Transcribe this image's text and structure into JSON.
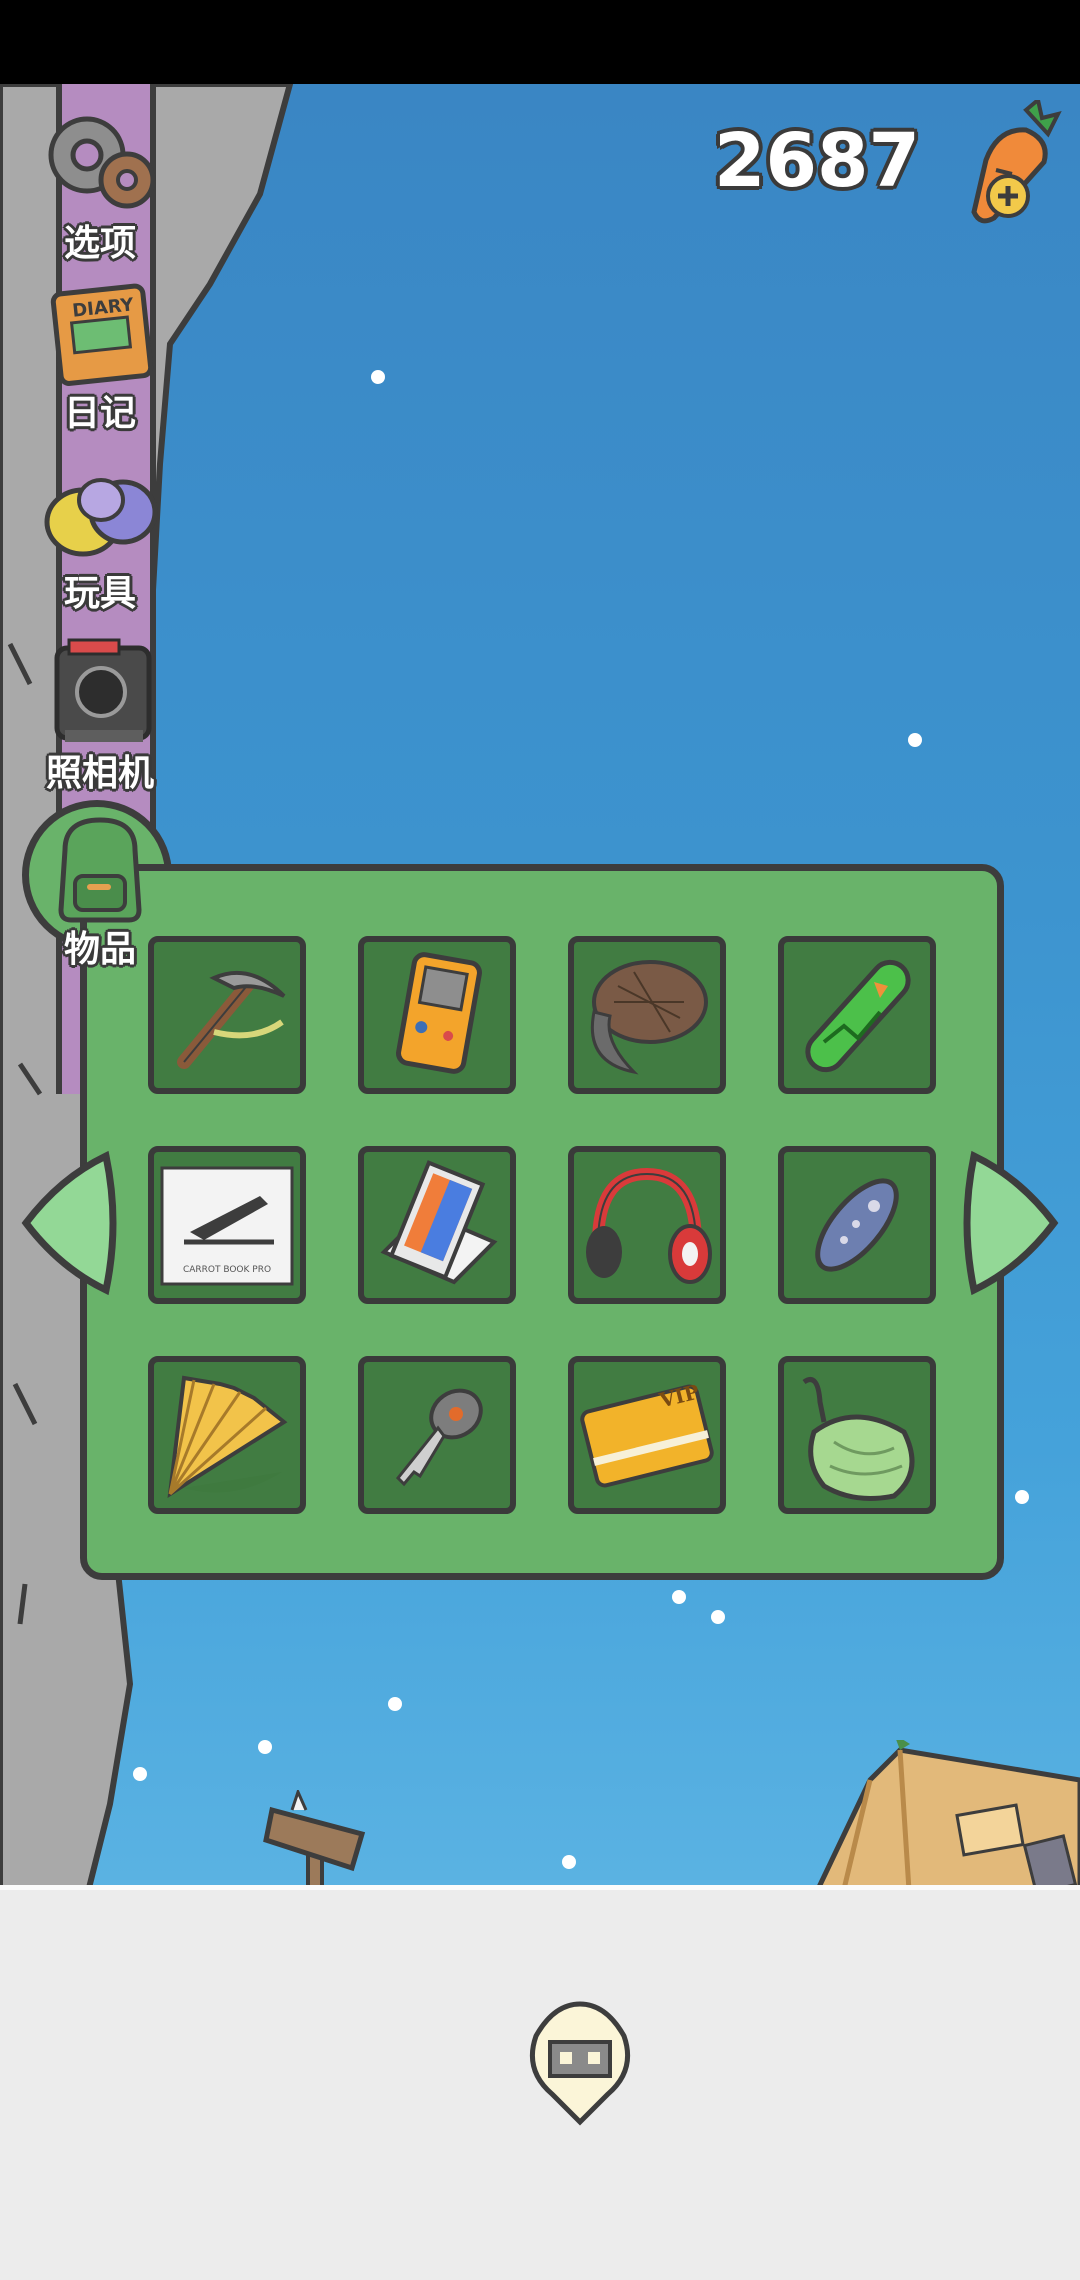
{
  "hud": {
    "carrot_count": "2687",
    "carrot_icon": "carrot-plus-icon"
  },
  "sidebar": {
    "items": [
      {
        "label": "选项",
        "icon": "gear-icon"
      },
      {
        "label": "日记",
        "icon": "diary-icon"
      },
      {
        "label": "玩具",
        "icon": "toys-icon"
      },
      {
        "label": "照相机",
        "icon": "camera-icon"
      },
      {
        "label": "物品",
        "icon": "backpack-icon",
        "selected": true
      }
    ]
  },
  "inventory": {
    "items": [
      {
        "name": "pickaxe",
        "icon": "pickaxe-icon"
      },
      {
        "name": "handheld-game",
        "icon": "game-console-icon"
      },
      {
        "name": "fur-hat",
        "icon": "fur-hat-icon"
      },
      {
        "name": "snowboard",
        "icon": "snowboard-icon"
      },
      {
        "name": "laptop",
        "icon": "laptop-icon",
        "text": "CARROT BOOK PRO"
      },
      {
        "name": "phone-box",
        "icon": "phone-box-icon"
      },
      {
        "name": "headphones",
        "icon": "headphones-icon"
      },
      {
        "name": "remote",
        "icon": "remote-icon"
      },
      {
        "name": "hand-fan",
        "icon": "fan-icon"
      },
      {
        "name": "car-key",
        "icon": "key-icon"
      },
      {
        "name": "vip-card",
        "icon": "vip-card-icon",
        "text": "VIP"
      },
      {
        "name": "cloth-bag",
        "icon": "pouch-icon"
      }
    ]
  },
  "colors": {
    "panel": "#69b36a",
    "slot": "#417c42",
    "outline": "#3d3d3d",
    "sky": "#3d94cf"
  }
}
